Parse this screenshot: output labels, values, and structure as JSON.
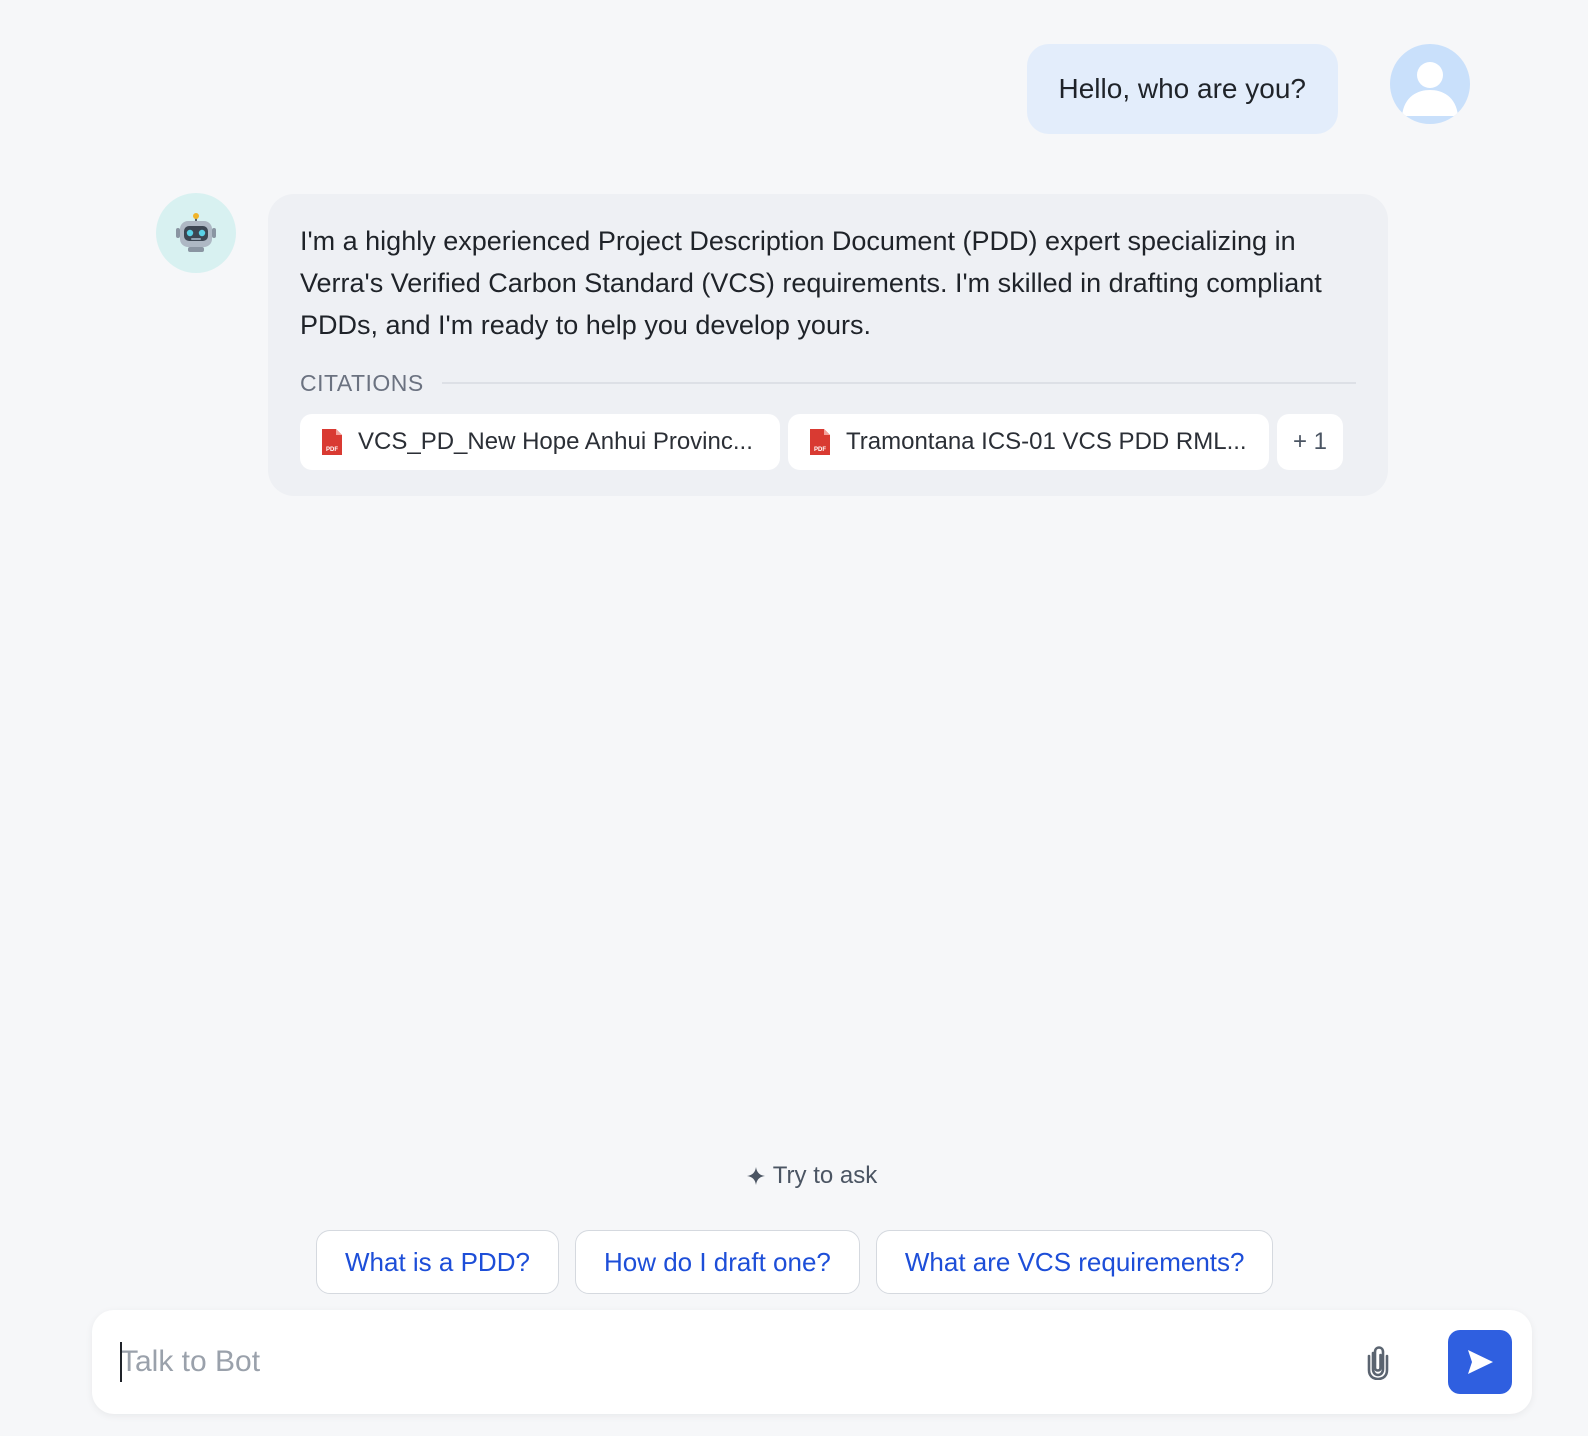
{
  "conversation": {
    "user_message": "Hello, who are you?",
    "bot_message": "I'm a highly experienced Project Description Document (PDD) expert specializing in Verra's Verified Carbon Standard (VCS) requirements. I'm skilled in drafting compliant PDDs, and I'm ready to help you develop yours.",
    "citations_label": "CITATIONS",
    "citations": [
      {
        "title": "VCS_PD_New Hope Anhui Provinc...",
        "icon": "pdf-icon"
      },
      {
        "title": "Tramontana ICS-01 VCS PDD RML...",
        "icon": "pdf-icon"
      }
    ],
    "citations_more": "+ 1",
    "bot_avatar_icon": "robot-icon",
    "user_avatar_icon": "user-icon"
  },
  "try_to_ask": {
    "label": "Try to ask",
    "icon": "sparkle-icon",
    "suggestions": [
      "What is a PDD?",
      "How do I draft one?",
      "What are VCS requirements?"
    ]
  },
  "input": {
    "placeholder": "Talk to Bot",
    "value": "",
    "attach_icon": "paperclip-icon",
    "send_icon": "send-icon"
  },
  "colors": {
    "accent": "#2f5fe0",
    "suggestion_text": "#1d4ed8",
    "user_bubble": "#e3edfb",
    "bot_bubble": "#eef0f4",
    "pdf_red": "#d93a32"
  }
}
